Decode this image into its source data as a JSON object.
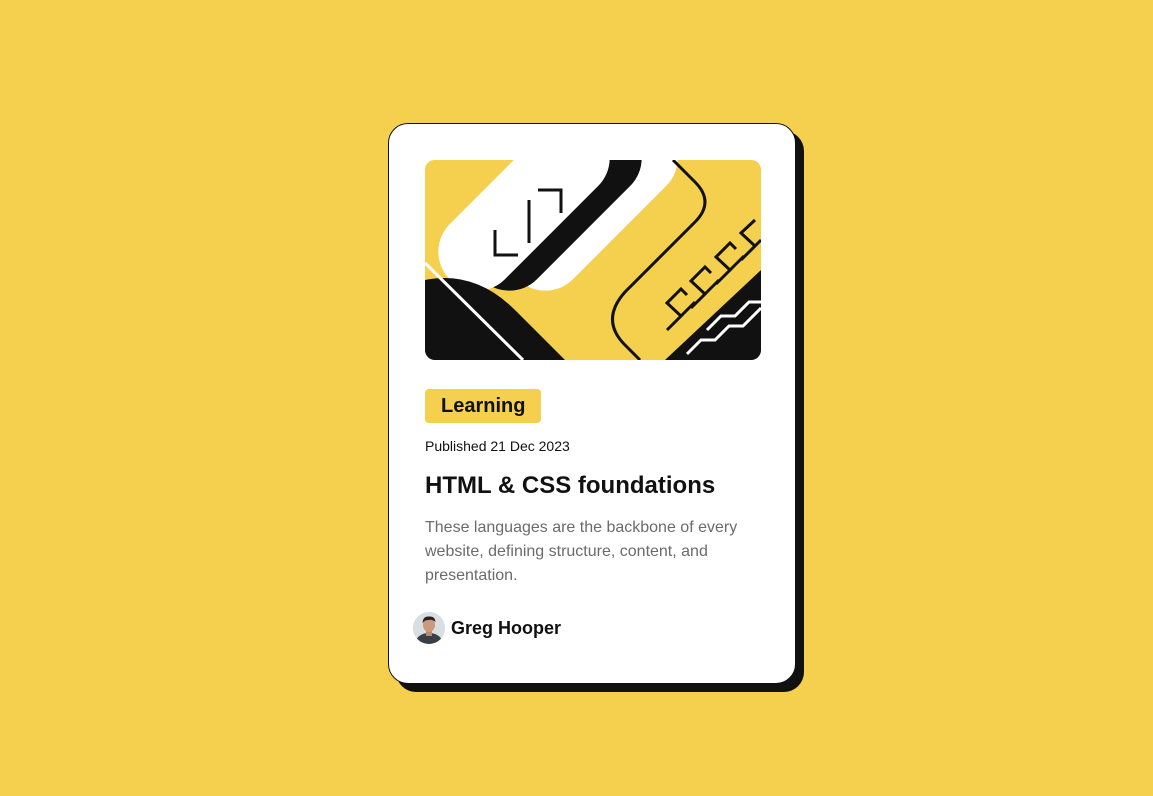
{
  "card": {
    "hero_image": "code-illustration",
    "tag": "Learning",
    "published": "Published 21 Dec 2023",
    "title": "HTML & CSS foundations",
    "description": "These languages are the backbone of every website, defining structure, content, and presentation.",
    "author": {
      "name": "Greg Hooper",
      "avatar": "avatar-photo"
    }
  },
  "colors": {
    "background": "#F4D04E",
    "card": "#FFFFFF",
    "ink": "#111111",
    "muted_text": "#6B6B6B"
  }
}
